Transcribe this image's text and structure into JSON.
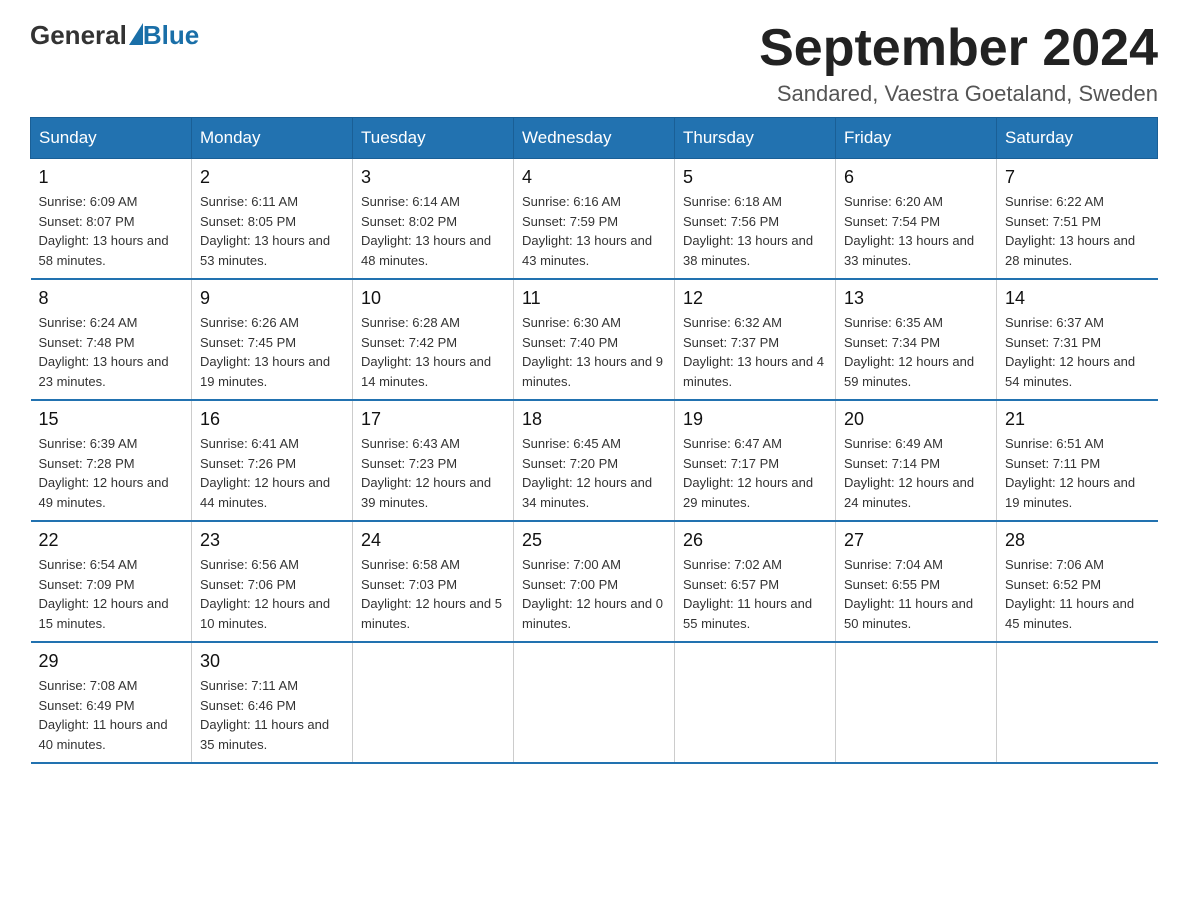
{
  "logo": {
    "text_general": "General",
    "text_blue": "Blue"
  },
  "title": "September 2024",
  "location": "Sandared, Vaestra Goetaland, Sweden",
  "days_of_week": [
    "Sunday",
    "Monday",
    "Tuesday",
    "Wednesday",
    "Thursday",
    "Friday",
    "Saturday"
  ],
  "weeks": [
    [
      {
        "day": "1",
        "sunrise": "6:09 AM",
        "sunset": "8:07 PM",
        "daylight": "13 hours and 58 minutes."
      },
      {
        "day": "2",
        "sunrise": "6:11 AM",
        "sunset": "8:05 PM",
        "daylight": "13 hours and 53 minutes."
      },
      {
        "day": "3",
        "sunrise": "6:14 AM",
        "sunset": "8:02 PM",
        "daylight": "13 hours and 48 minutes."
      },
      {
        "day": "4",
        "sunrise": "6:16 AM",
        "sunset": "7:59 PM",
        "daylight": "13 hours and 43 minutes."
      },
      {
        "day": "5",
        "sunrise": "6:18 AM",
        "sunset": "7:56 PM",
        "daylight": "13 hours and 38 minutes."
      },
      {
        "day": "6",
        "sunrise": "6:20 AM",
        "sunset": "7:54 PM",
        "daylight": "13 hours and 33 minutes."
      },
      {
        "day": "7",
        "sunrise": "6:22 AM",
        "sunset": "7:51 PM",
        "daylight": "13 hours and 28 minutes."
      }
    ],
    [
      {
        "day": "8",
        "sunrise": "6:24 AM",
        "sunset": "7:48 PM",
        "daylight": "13 hours and 23 minutes."
      },
      {
        "day": "9",
        "sunrise": "6:26 AM",
        "sunset": "7:45 PM",
        "daylight": "13 hours and 19 minutes."
      },
      {
        "day": "10",
        "sunrise": "6:28 AM",
        "sunset": "7:42 PM",
        "daylight": "13 hours and 14 minutes."
      },
      {
        "day": "11",
        "sunrise": "6:30 AM",
        "sunset": "7:40 PM",
        "daylight": "13 hours and 9 minutes."
      },
      {
        "day": "12",
        "sunrise": "6:32 AM",
        "sunset": "7:37 PM",
        "daylight": "13 hours and 4 minutes."
      },
      {
        "day": "13",
        "sunrise": "6:35 AM",
        "sunset": "7:34 PM",
        "daylight": "12 hours and 59 minutes."
      },
      {
        "day": "14",
        "sunrise": "6:37 AM",
        "sunset": "7:31 PM",
        "daylight": "12 hours and 54 minutes."
      }
    ],
    [
      {
        "day": "15",
        "sunrise": "6:39 AM",
        "sunset": "7:28 PM",
        "daylight": "12 hours and 49 minutes."
      },
      {
        "day": "16",
        "sunrise": "6:41 AM",
        "sunset": "7:26 PM",
        "daylight": "12 hours and 44 minutes."
      },
      {
        "day": "17",
        "sunrise": "6:43 AM",
        "sunset": "7:23 PM",
        "daylight": "12 hours and 39 minutes."
      },
      {
        "day": "18",
        "sunrise": "6:45 AM",
        "sunset": "7:20 PM",
        "daylight": "12 hours and 34 minutes."
      },
      {
        "day": "19",
        "sunrise": "6:47 AM",
        "sunset": "7:17 PM",
        "daylight": "12 hours and 29 minutes."
      },
      {
        "day": "20",
        "sunrise": "6:49 AM",
        "sunset": "7:14 PM",
        "daylight": "12 hours and 24 minutes."
      },
      {
        "day": "21",
        "sunrise": "6:51 AM",
        "sunset": "7:11 PM",
        "daylight": "12 hours and 19 minutes."
      }
    ],
    [
      {
        "day": "22",
        "sunrise": "6:54 AM",
        "sunset": "7:09 PM",
        "daylight": "12 hours and 15 minutes."
      },
      {
        "day": "23",
        "sunrise": "6:56 AM",
        "sunset": "7:06 PM",
        "daylight": "12 hours and 10 minutes."
      },
      {
        "day": "24",
        "sunrise": "6:58 AM",
        "sunset": "7:03 PM",
        "daylight": "12 hours and 5 minutes."
      },
      {
        "day": "25",
        "sunrise": "7:00 AM",
        "sunset": "7:00 PM",
        "daylight": "12 hours and 0 minutes."
      },
      {
        "day": "26",
        "sunrise": "7:02 AM",
        "sunset": "6:57 PM",
        "daylight": "11 hours and 55 minutes."
      },
      {
        "day": "27",
        "sunrise": "7:04 AM",
        "sunset": "6:55 PM",
        "daylight": "11 hours and 50 minutes."
      },
      {
        "day": "28",
        "sunrise": "7:06 AM",
        "sunset": "6:52 PM",
        "daylight": "11 hours and 45 minutes."
      }
    ],
    [
      {
        "day": "29",
        "sunrise": "7:08 AM",
        "sunset": "6:49 PM",
        "daylight": "11 hours and 40 minutes."
      },
      {
        "day": "30",
        "sunrise": "7:11 AM",
        "sunset": "6:46 PM",
        "daylight": "11 hours and 35 minutes."
      },
      null,
      null,
      null,
      null,
      null
    ]
  ],
  "labels": {
    "sunrise": "Sunrise:",
    "sunset": "Sunset:",
    "daylight": "Daylight:"
  }
}
